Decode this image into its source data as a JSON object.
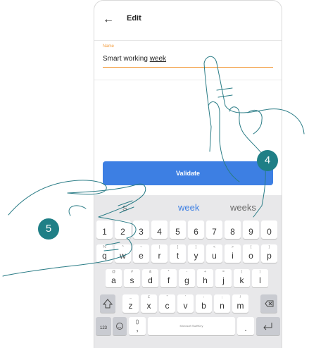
{
  "header": {
    "back_icon": "arrow-left-icon",
    "title": "Edit"
  },
  "form": {
    "name_label": "Name",
    "name_value_prefix": "Smart working ",
    "name_value_underlined": "week"
  },
  "validate_label": "Validate",
  "steps": {
    "step_a": "4",
    "step_b": "5"
  },
  "keyboard": {
    "suggestions": [
      "s",
      "week",
      "weeks"
    ],
    "row_numbers": [
      "1",
      "2",
      "3",
      "4",
      "5",
      "6",
      "7",
      "8",
      "9",
      "0"
    ],
    "row1": [
      [
        "q",
        "%"
      ],
      [
        "w",
        "^"
      ],
      [
        "e",
        "~"
      ],
      [
        "r",
        "|"
      ],
      [
        "t",
        "["
      ],
      [
        "y",
        "]"
      ],
      [
        "u",
        "<"
      ],
      [
        "i",
        ">"
      ],
      [
        "o",
        "{"
      ],
      [
        "p",
        "}"
      ]
    ],
    "row2": [
      [
        "a",
        "@"
      ],
      [
        "s",
        "#"
      ],
      [
        "d",
        "&"
      ],
      [
        "f",
        "*"
      ],
      [
        "g",
        "-"
      ],
      [
        "h",
        "+"
      ],
      [
        "j",
        "="
      ],
      [
        "k",
        "("
      ],
      [
        "l",
        ")"
      ]
    ],
    "row3": [
      [
        "z",
        "_"
      ],
      [
        "x",
        "£"
      ],
      [
        "c",
        "\""
      ],
      [
        "v",
        "'"
      ],
      [
        "b",
        ":"
      ],
      [
        "n",
        ";"
      ],
      [
        "m",
        "/"
      ]
    ],
    "bottom": {
      "num_label": "123",
      "space_label": "Microsoft SwiftKey"
    },
    "icons": {
      "shift": "shift-icon",
      "backspace": "backspace-icon",
      "emoji": "emoji-icon",
      "mic": "microphone-icon",
      "enter": "enter-icon"
    }
  },
  "colors": {
    "accent_orange": "#f39c3d",
    "button_blue": "#3d7fe3",
    "badge_teal": "#1f7f86",
    "keyboard_bg": "#e8e8ea"
  }
}
